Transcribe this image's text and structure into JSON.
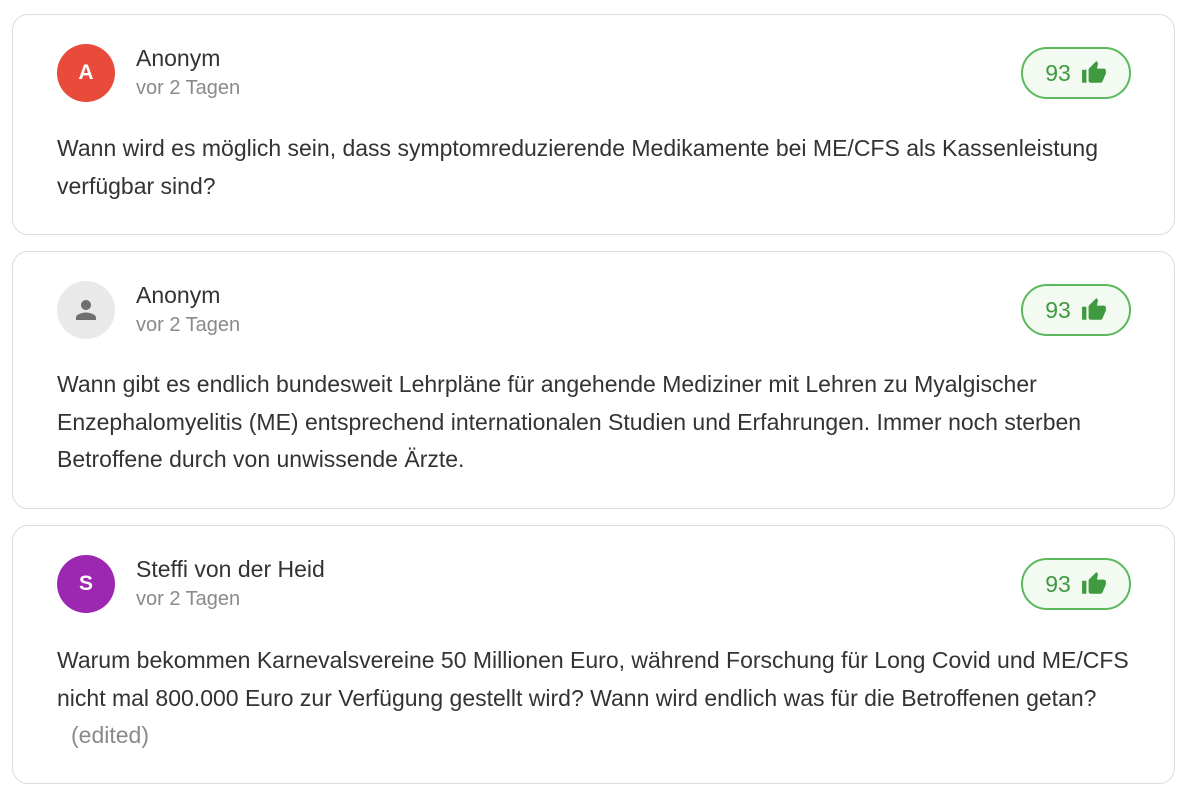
{
  "comments": [
    {
      "avatar_letter": "A",
      "avatar_color": "#e84a3c",
      "avatar_icon": null,
      "author": "Anonym",
      "time": "vor 2 Tagen",
      "votes": "93",
      "vote_icon": "thumbs-up-icon",
      "text": "Wann wird es möglich sein, dass symptomreduzierende Medikamente bei ME/CFS als Kassenleistung verfügbar sind?",
      "edited": ""
    },
    {
      "avatar_letter": "",
      "avatar_color": "#e9e9e9",
      "avatar_icon": "person-icon",
      "author": "Anonym",
      "time": "vor 2 Tagen",
      "votes": "93",
      "vote_icon": "thumbs-up-icon",
      "text": "Wann gibt es endlich bundesweit Lehrpläne für angehende Mediziner mit Lehren zu Myalgischer Enzephalomyelitis (ME) entsprechend internationalen Studien und Erfahrungen. Immer noch sterben Betroffene durch von unwissende Ärzte.",
      "edited": ""
    },
    {
      "avatar_letter": "S",
      "avatar_color": "#9c27b0",
      "avatar_icon": null,
      "author": "Steffi von der Heid",
      "time": "vor 2 Tagen",
      "votes": "93",
      "vote_icon": "thumbs-up-icon",
      "text": "Warum bekommen Karnevalsvereine 50 Millionen Euro, während Forschung für Long Covid und ME/CFS nicht mal 800.000 Euro zur Verfügung gestellt wird? Wann wird endlich was für die Betroffenen getan?",
      "edited": "(edited)"
    }
  ],
  "colors": {
    "vote_border": "#5cb85c",
    "vote_text": "#3f9a3f",
    "vote_bg": "#f2faf2",
    "card_border": "#dcdcdc",
    "secondary_text": "#8a8a8a"
  }
}
